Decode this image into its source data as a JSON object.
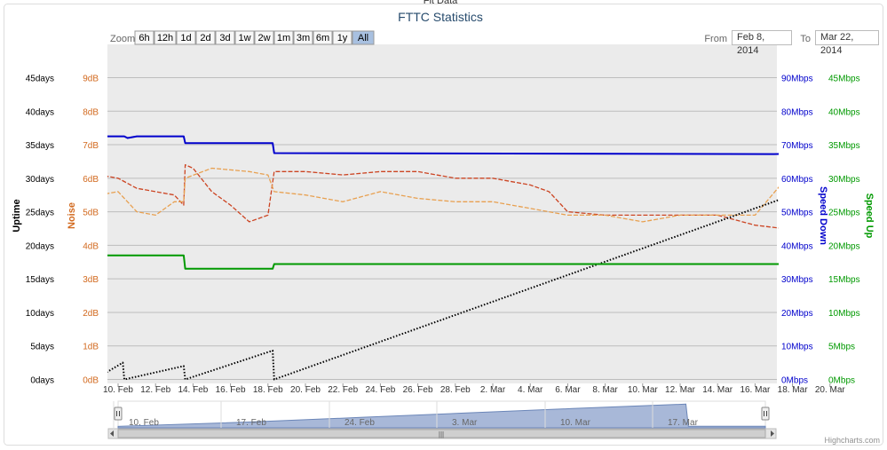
{
  "chart_data": {
    "type": "line",
    "title": "FTTC Statistics",
    "top_partial_text": "Fit Data",
    "x_ticks": [
      "10. Feb",
      "12. Feb",
      "14. Feb",
      "16. Feb",
      "18. Feb",
      "20. Feb",
      "22. Feb",
      "24. Feb",
      "26. Feb",
      "28. Feb",
      "2. Mar",
      "4. Mar",
      "6. Mar",
      "8. Mar",
      "10. Mar",
      "12. Mar",
      "14. Mar",
      "16. Mar",
      "18. Mar",
      "20. Mar"
    ],
    "x_range": [
      "2014-02-08",
      "2014-03-22"
    ],
    "grid": true,
    "legend": "none",
    "axes": {
      "uptime": {
        "title": "Uptime",
        "unit": "days",
        "range": [
          0,
          45
        ],
        "color": "#000000",
        "ticks": [
          "0days",
          "5days",
          "10days",
          "15days",
          "20days",
          "25days",
          "30days",
          "35days",
          "40days",
          "45days"
        ]
      },
      "noise": {
        "title": "Noise",
        "unit": "dB",
        "range": [
          0,
          9
        ],
        "color": "#d2691e",
        "ticks": [
          "0dB",
          "1dB",
          "2dB",
          "3dB",
          "4dB",
          "5dB",
          "6dB",
          "7dB",
          "8dB",
          "9dB"
        ]
      },
      "speed_down": {
        "title": "Speed Down",
        "unit": "Mbps",
        "range": [
          0,
          90
        ],
        "color": "#0000cc",
        "ticks": [
          "0Mbps",
          "10Mbps",
          "20Mbps",
          "30Mbps",
          "40Mbps",
          "50Mbps",
          "60Mbps",
          "70Mbps",
          "80Mbps",
          "90Mbps"
        ]
      },
      "speed_up": {
        "title": "Speed Up",
        "unit": "Mbps",
        "range": [
          0,
          45
        ],
        "color": "#009900",
        "ticks": [
          "0Mbps",
          "5Mbps",
          "10Mbps",
          "15Mbps",
          "20Mbps",
          "25Mbps",
          "30Mbps",
          "35Mbps",
          "40Mbps",
          "45Mbps"
        ]
      }
    },
    "series": [
      {
        "axis": "speed_down",
        "color": "#0000cc",
        "style": "solid",
        "points": [
          [
            "2014-02-08",
            66
          ],
          [
            "2014-02-08T12",
            72.5
          ],
          [
            "2014-02-10T08",
            72.5
          ],
          [
            "2014-02-10T12",
            72
          ],
          [
            "2014-02-11",
            72.5
          ],
          [
            "2014-02-13T12",
            72.5
          ],
          [
            "2014-02-13T14",
            70.5
          ],
          [
            "2014-02-18T06",
            70.5
          ],
          [
            "2014-02-18T08",
            67.5
          ],
          [
            "2014-03-17",
            67.2
          ],
          [
            "2014-03-22T12",
            67.5
          ],
          [
            "2014-03-22T18",
            66
          ]
        ]
      },
      {
        "axis": "speed_up",
        "color": "#009900",
        "style": "solid",
        "points": [
          [
            "2014-02-08",
            16.5
          ],
          [
            "2014-02-08T12",
            18.5
          ],
          [
            "2014-02-13T12",
            18.5
          ],
          [
            "2014-02-13T14",
            16.5
          ],
          [
            "2014-02-18T06",
            16.5
          ],
          [
            "2014-02-18T08",
            17.2
          ],
          [
            "2014-03-17T12",
            17.2
          ],
          [
            "2014-03-17T16",
            14.8
          ],
          [
            "2014-03-22T12",
            14.8
          ],
          [
            "2014-03-22T18",
            15.3
          ]
        ]
      },
      {
        "axis": "uptime",
        "color": "#000000",
        "style": "dotted",
        "points": [
          [
            "2014-02-08",
            2.2
          ],
          [
            "2014-02-08T18",
            0
          ],
          [
            "2014-02-10T06",
            2.5
          ],
          [
            "2014-02-10T08",
            0
          ],
          [
            "2014-02-13T12",
            2
          ],
          [
            "2014-02-13T14",
            0
          ],
          [
            "2014-02-18T06",
            4.3
          ],
          [
            "2014-02-18T08",
            0
          ],
          [
            "2014-03-17T12",
            27
          ],
          [
            "2014-03-17T16",
            0
          ],
          [
            "2014-03-22T12",
            4.5
          ],
          [
            "2014-03-22T18",
            0
          ]
        ]
      },
      {
        "axis": "noise",
        "color": "#cc4422",
        "style": "dashed",
        "points": [
          [
            "2014-02-08",
            8.3
          ],
          [
            "2014-02-08T06",
            8.4
          ],
          [
            "2014-02-08T14",
            6.2
          ],
          [
            "2014-02-09",
            6.1
          ],
          [
            "2014-02-10",
            6
          ],
          [
            "2014-02-11",
            5.7
          ],
          [
            "2014-02-12",
            5.6
          ],
          [
            "2014-02-13",
            5.5
          ],
          [
            "2014-02-13T12",
            5.2
          ],
          [
            "2014-02-13T14",
            6.4
          ],
          [
            "2014-02-14",
            6.3
          ],
          [
            "2014-02-15",
            5.6
          ],
          [
            "2014-02-16",
            5.2
          ],
          [
            "2014-02-17",
            4.7
          ],
          [
            "2014-02-18",
            4.9
          ],
          [
            "2014-02-18T08",
            6.2
          ],
          [
            "2014-02-20",
            6.2
          ],
          [
            "2014-02-22",
            6.1
          ],
          [
            "2014-02-24",
            6.2
          ],
          [
            "2014-02-26",
            6.2
          ],
          [
            "2014-02-28",
            6.0
          ],
          [
            "2014-03-02",
            6.0
          ],
          [
            "2014-03-04",
            5.8
          ],
          [
            "2014-03-05",
            5.6
          ],
          [
            "2014-03-06",
            5.0
          ],
          [
            "2014-03-08",
            4.9
          ],
          [
            "2014-03-10",
            4.9
          ],
          [
            "2014-03-12",
            4.9
          ],
          [
            "2014-03-14",
            4.9
          ],
          [
            "2014-03-16",
            4.6
          ],
          [
            "2014-03-17T12",
            4.5
          ],
          [
            "2014-03-17T16",
            6.1
          ],
          [
            "2014-03-19",
            6.2
          ],
          [
            "2014-03-21",
            6.2
          ],
          [
            "2014-03-22",
            6.3
          ],
          [
            "2014-03-22T12",
            5.2
          ]
        ]
      },
      {
        "axis": "noise",
        "color": "#e8a050",
        "style": "dashed",
        "points": [
          [
            "2014-02-08",
            5.4
          ],
          [
            "2014-02-09",
            5.5
          ],
          [
            "2014-02-10",
            5.6
          ],
          [
            "2014-02-11",
            5.0
          ],
          [
            "2014-02-12",
            4.9
          ],
          [
            "2014-02-13",
            5.3
          ],
          [
            "2014-02-13T12",
            5.3
          ],
          [
            "2014-02-13T14",
            6.0
          ],
          [
            "2014-02-15",
            6.3
          ],
          [
            "2014-02-17",
            6.2
          ],
          [
            "2014-02-18",
            6.1
          ],
          [
            "2014-02-18T08",
            5.6
          ],
          [
            "2014-02-20",
            5.5
          ],
          [
            "2014-02-22",
            5.3
          ],
          [
            "2014-02-24",
            5.6
          ],
          [
            "2014-02-26",
            5.4
          ],
          [
            "2014-02-28",
            5.3
          ],
          [
            "2014-03-02",
            5.3
          ],
          [
            "2014-03-04",
            5.1
          ],
          [
            "2014-03-06",
            4.9
          ],
          [
            "2014-03-08",
            4.9
          ],
          [
            "2014-03-10",
            4.7
          ],
          [
            "2014-03-12",
            4.9
          ],
          [
            "2014-03-14",
            4.9
          ],
          [
            "2014-03-16",
            4.9
          ],
          [
            "2014-03-17T16",
            6.0
          ],
          [
            "2014-03-19",
            6.0
          ],
          [
            "2014-03-21",
            6.1
          ],
          [
            "2014-03-22",
            6.6
          ],
          [
            "2014-03-22T12",
            5.5
          ]
        ]
      }
    ]
  },
  "range_selector": {
    "zoom_label": "Zoom",
    "buttons": [
      "6h",
      "12h",
      "1d",
      "2d",
      "3d",
      "1w",
      "2w",
      "1m",
      "3m",
      "6m",
      "1y",
      "All"
    ],
    "selected": "All",
    "from_label": "From",
    "from_value": "Feb 8, 2014",
    "to_label": "To",
    "to_value": "Mar 22, 2014"
  },
  "navigator": {
    "labels": [
      "10. Feb",
      "17. Feb",
      "24. Feb",
      "3. Mar",
      "10. Mar",
      "17. Mar"
    ],
    "fill_color": "#a8b8d8",
    "profile": [
      [
        "2014-02-08",
        1
      ],
      [
        "2014-02-17",
        4
      ],
      [
        "2014-02-24",
        7
      ],
      [
        "2014-03-03",
        10
      ],
      [
        "2014-03-10",
        13
      ],
      [
        "2014-03-17T12",
        16
      ],
      [
        "2014-03-17T16",
        1
      ],
      [
        "2014-03-22T18",
        1
      ]
    ]
  },
  "credits": "Highcharts.com"
}
